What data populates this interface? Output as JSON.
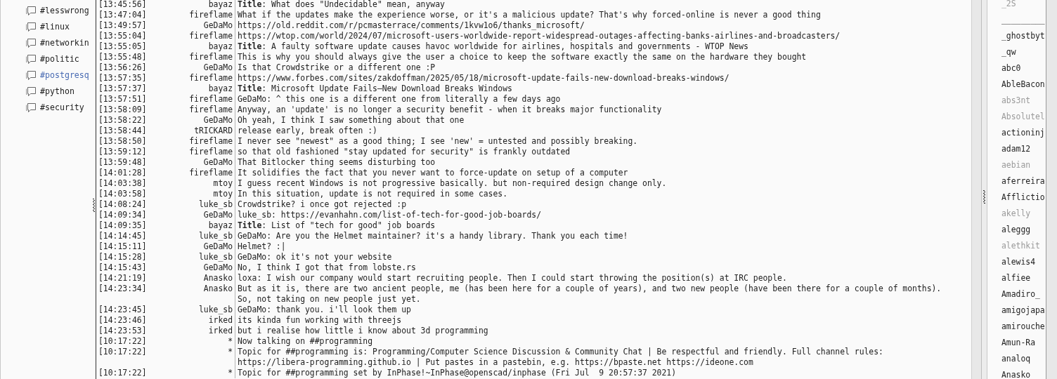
{
  "channels": [
    {
      "name": "#lesswrong",
      "highlighted": false
    },
    {
      "name": "#linux",
      "highlighted": false
    },
    {
      "name": "#networkin",
      "highlighted": false
    },
    {
      "name": "#politic",
      "highlighted": false
    },
    {
      "name": "#postgresq",
      "highlighted": true
    },
    {
      "name": "#python",
      "highlighted": false
    },
    {
      "name": "#security",
      "highlighted": false
    }
  ],
  "messages": [
    {
      "time": "[13:45:56]",
      "nick": "bayaz",
      "text": "**Title**: What does \"Undecidable\" mean, anyway"
    },
    {
      "time": "[13:47:04]",
      "nick": "fireflame",
      "text": "What if the updates make the experience worse, or it's a malicious update? That's why forced-online is never a good thing"
    },
    {
      "time": "[13:49:57]",
      "nick": "GeDaMo",
      "text": "https://old.reddit.com/r/pcmasterrace/comments/1kvw1o6/thanks_microsoft/"
    },
    {
      "time": "[13:55:04]",
      "nick": "fireflame",
      "text": "https://wtop.com/world/2024/07/microsoft-users-worldwide-report-widespread-outages-affecting-banks-airlines-and-broadcasters/"
    },
    {
      "time": "[13:55:05]",
      "nick": "bayaz",
      "text": "**Title**: A faulty software update causes havoc worldwide for airlines, hospitals and governments - WTOP News"
    },
    {
      "time": "[13:55:48]",
      "nick": "fireflame",
      "text": "This is why you should always give the user a choice to keep the software exactly the same on the hardware they bought"
    },
    {
      "time": "[13:56:26]",
      "nick": "GeDaMo",
      "text": "Is that Crowdstrike or a different one :P"
    },
    {
      "time": "[13:57:35]",
      "nick": "fireflame",
      "text": "https://www.forbes.com/sites/zakdoffman/2025/05/18/microsoft-update-fails-new-download-breaks-windows/"
    },
    {
      "time": "[13:57:37]",
      "nick": "bayaz",
      "text": "**Title**: Microsoft Update Fails—New Download Breaks Windows"
    },
    {
      "time": "[13:57:51]",
      "nick": "fireflame",
      "text": "GeDaMo: ^ this one is a different one from literally a few days ago"
    },
    {
      "time": "[13:58:09]",
      "nick": "fireflame",
      "text": "Anyway, an 'update' is no longer a security benefit - when it breaks major functionality"
    },
    {
      "time": "[13:58:22]",
      "nick": "GeDaMo",
      "text": "Oh yeah, I think I saw something about that one"
    },
    {
      "time": "[13:58:44]",
      "nick": "tRICKARD",
      "text": "release early, break often :)"
    },
    {
      "time": "[13:58:50]",
      "nick": "fireflame",
      "text": "I never see \"newest\" as a good thing; I see 'new' = untested and possibly breaking."
    },
    {
      "time": "[13:59:12]",
      "nick": "fireflame",
      "text": "so that old fashioned \"stay updated for security\" is frankly outdated"
    },
    {
      "time": "[13:59:48]",
      "nick": "GeDaMo",
      "text": "That Bitlocker thing seems disturbing too"
    },
    {
      "time": "[14:01:28]",
      "nick": "fireflame",
      "text": "It solidifies the fact that you never want to force-update on setup of a computer"
    },
    {
      "time": "[14:03:38]",
      "nick": "mtoy",
      "text": "I guess recent Windows is not progressive basically. but non-required design change only."
    },
    {
      "time": "[14:03:58]",
      "nick": "mtoy",
      "text": "In this situation, update is not required in some cases."
    },
    {
      "time": "[14:08:24]",
      "nick": "luke_sb",
      "text": "Crowdstrike? i once got rejected :p"
    },
    {
      "time": "[14:09:34]",
      "nick": "GeDaMo",
      "text": "luke_sb: https://evanhahn.com/list-of-tech-for-good-job-boards/"
    },
    {
      "time": "[14:09:35]",
      "nick": "bayaz",
      "text": "**Title**: List of \"tech for good\" job boards"
    },
    {
      "time": "[14:14:45]",
      "nick": "luke_sb",
      "text": "GeDaMo: Are you the Helmet maintainer? it's a handy library. Thank you each time!"
    },
    {
      "time": "[14:15:11]",
      "nick": "GeDaMo",
      "text": "Helmet? :|"
    },
    {
      "time": "[14:15:28]",
      "nick": "luke_sb",
      "text": "GeDaMo: ok it's not your website"
    },
    {
      "time": "[14:15:43]",
      "nick": "GeDaMo",
      "text": "No, I think I got that from lobste.rs"
    },
    {
      "time": "[14:21:19]",
      "nick": "Anasko",
      "text": "loxa: I wish our company would start recruiting people. Then I could start throwing the position(s) at IRC people."
    },
    {
      "time": "[14:23:34]",
      "nick": "Anasko",
      "text": "But as it is, there are two ancient people, me (has been here for a couple of years), and two new people (have been there for a couple of months). So, not taking on new people just yet."
    },
    {
      "time": "[14:23:45]",
      "nick": "luke_sb",
      "text": "GeDaMo: thank you. i'll look them up"
    },
    {
      "time": "[14:23:46]",
      "nick": "irked",
      "text": "its kinda fun working with threejs"
    },
    {
      "time": "[14:23:53]",
      "nick": "irked",
      "text": "but i realise how little i know about 3d programming"
    },
    {
      "time": "[10:17:22]",
      "nick": "*",
      "text": "Now talking on ##programming"
    },
    {
      "time": "[10:17:22]",
      "nick": "*",
      "text": "Topic for ##programming is: Programming/Computer Science Discussion & Community Chat | Be respectful and friendly. Full channel rules: https://libera-programming.github.io | Put pastes in a pastebin, e.g. https://bpaste.net https://ideone.com"
    },
    {
      "time": "[10:17:22]",
      "nick": "*",
      "text": "Topic for ##programming set by InPhase!~InPhase@openscad/inphase (Fri Jul  9 20:57:37 2021)"
    }
  ],
  "users": [
    {
      "nick": "_2S",
      "away": true
    },
    {
      "nick": "_________",
      "away": false
    },
    {
      "nick": "_ghostbyt",
      "away": false
    },
    {
      "nick": "_qw",
      "away": false
    },
    {
      "nick": "abc0",
      "away": false
    },
    {
      "nick": "AbleBacon",
      "away": false
    },
    {
      "nick": "abs3nt",
      "away": true
    },
    {
      "nick": "Absolutel",
      "away": true
    },
    {
      "nick": "actioninj",
      "away": false
    },
    {
      "nick": "adam12",
      "away": false
    },
    {
      "nick": "aebian",
      "away": true
    },
    {
      "nick": "aferreira",
      "away": false
    },
    {
      "nick": "Afflictio",
      "away": false
    },
    {
      "nick": "akelly",
      "away": true
    },
    {
      "nick": "aleggg",
      "away": false
    },
    {
      "nick": "alethkit",
      "away": true
    },
    {
      "nick": "alewis4",
      "away": false
    },
    {
      "nick": "alfiee",
      "away": false
    },
    {
      "nick": "Amadiro_",
      "away": false
    },
    {
      "nick": "amigojapa",
      "away": false
    },
    {
      "nick": "amirouche",
      "away": false
    },
    {
      "nick": "Amun-Ra",
      "away": false
    },
    {
      "nick": "analoq",
      "away": false
    },
    {
      "nick": "Anasko",
      "away": false
    }
  ]
}
